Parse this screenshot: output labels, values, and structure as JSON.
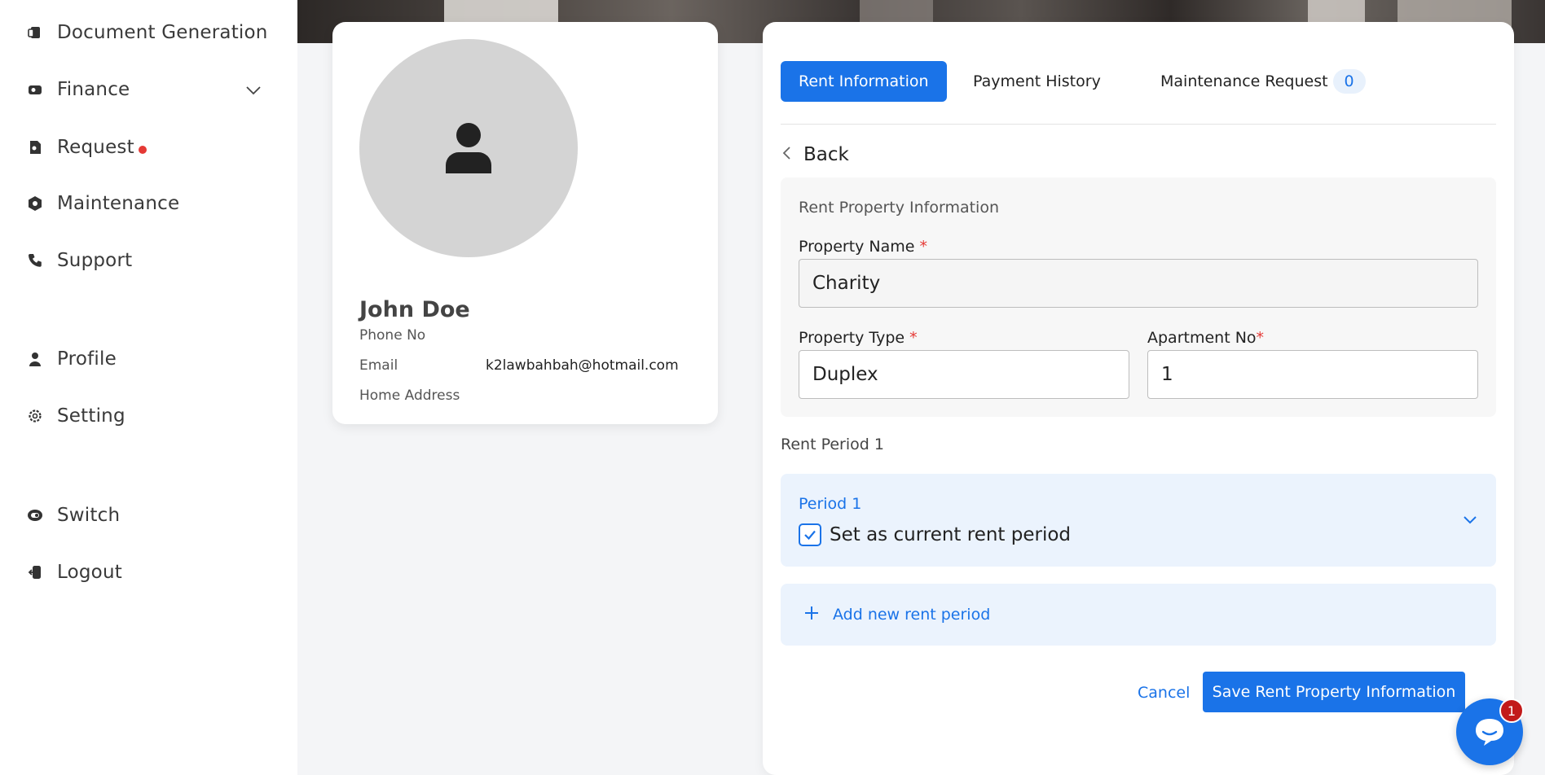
{
  "sidebar": {
    "items": [
      {
        "label": "Document Generation",
        "icon": "document-icon"
      },
      {
        "label": "Finance",
        "icon": "finance-icon"
      },
      {
        "label": "Request",
        "icon": "request-icon"
      },
      {
        "label": "Maintenance",
        "icon": "maintenance-icon"
      },
      {
        "label": "Support",
        "icon": "phone-icon"
      },
      {
        "label": "Profile",
        "icon": "user-icon"
      },
      {
        "label": "Setting",
        "icon": "gear-icon"
      },
      {
        "label": "Switch",
        "icon": "switch-icon"
      },
      {
        "label": "Logout",
        "icon": "logout-icon"
      }
    ]
  },
  "profile": {
    "name": "John Doe",
    "phone_label": "Phone No",
    "phone_value": "",
    "email_label": "Email",
    "email_value": "k2lawbahbah@hotmail.com",
    "address_label": "Home Address",
    "address_value": ""
  },
  "tabs": [
    {
      "label": "Rent Information",
      "active": true
    },
    {
      "label": "Payment History",
      "active": false
    },
    {
      "label": "Maintenance Request",
      "active": false,
      "count": "0"
    }
  ],
  "back_label": "Back",
  "rent_info": {
    "title": "Rent Property Information",
    "property_name_label": "Property Name",
    "property_name_value": "Charity",
    "property_type_label": "Property Type",
    "property_type_value": "Duplex",
    "apartment_no_label": "Apartment No",
    "apartment_no_value": "1",
    "required_mark": "*"
  },
  "rent_period": {
    "section_label": "Rent Period 1",
    "period_title": "Period 1",
    "current_checkbox_label": "Set as current rent period",
    "current_checked": true,
    "add_label": "Add new rent period"
  },
  "actions": {
    "cancel_label": "Cancel",
    "save_label": "Save Rent Property Information"
  },
  "chat": {
    "badge_count": "1"
  },
  "colors": {
    "accent": "#1a73e8",
    "danger": "#e53935",
    "panel_blue": "#ebf3fd"
  }
}
